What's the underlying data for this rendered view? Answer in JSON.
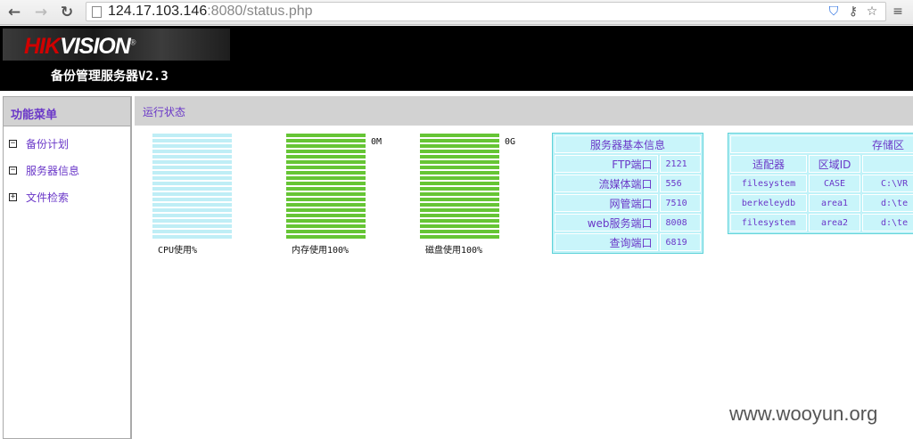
{
  "browser": {
    "url_host": "124.17.103.146",
    "url_rest": ":8080/status.php"
  },
  "header": {
    "logo_hik": "HIK",
    "logo_vision": "VISION",
    "logo_tm": "®",
    "title": "备份管理服务器V2.3"
  },
  "sidebar": {
    "heading": "功能菜单",
    "items": [
      {
        "label": "备份计划",
        "toggle": "−"
      },
      {
        "label": "服务器信息",
        "toggle": "−"
      },
      {
        "label": "文件检索",
        "toggle": "+"
      }
    ]
  },
  "main": {
    "heading": "运行状态",
    "gauges": [
      {
        "label": "CPU使用%",
        "side": "",
        "percent": 0,
        "color": "#bfeef6"
      },
      {
        "label": "内存使用100%",
        "side": "0M",
        "percent": 100,
        "color": "#66c535"
      },
      {
        "label": "磁盘使用100%",
        "side": "0G",
        "percent": 100,
        "color": "#66c535"
      }
    ],
    "server_info": {
      "title": "服务器基本信息",
      "rows": [
        {
          "key": "FTP端口",
          "value": "2121"
        },
        {
          "key": "流媒体端口",
          "value": "556"
        },
        {
          "key": "网管端口",
          "value": "7510"
        },
        {
          "key": "web服务端口",
          "value": "8008"
        },
        {
          "key": "查询端口",
          "value": "6819"
        }
      ]
    },
    "storage": {
      "title": "存储区",
      "columns": [
        "适配器",
        "区域ID",
        "路"
      ],
      "rows": [
        [
          "filesystem",
          "CASE",
          "C:\\VR"
        ],
        [
          "berkeleydb",
          "area1",
          "d:\\te"
        ],
        [
          "filesystem",
          "area2",
          "d:\\te"
        ]
      ]
    }
  },
  "watermark": "www.wooyun.org"
}
